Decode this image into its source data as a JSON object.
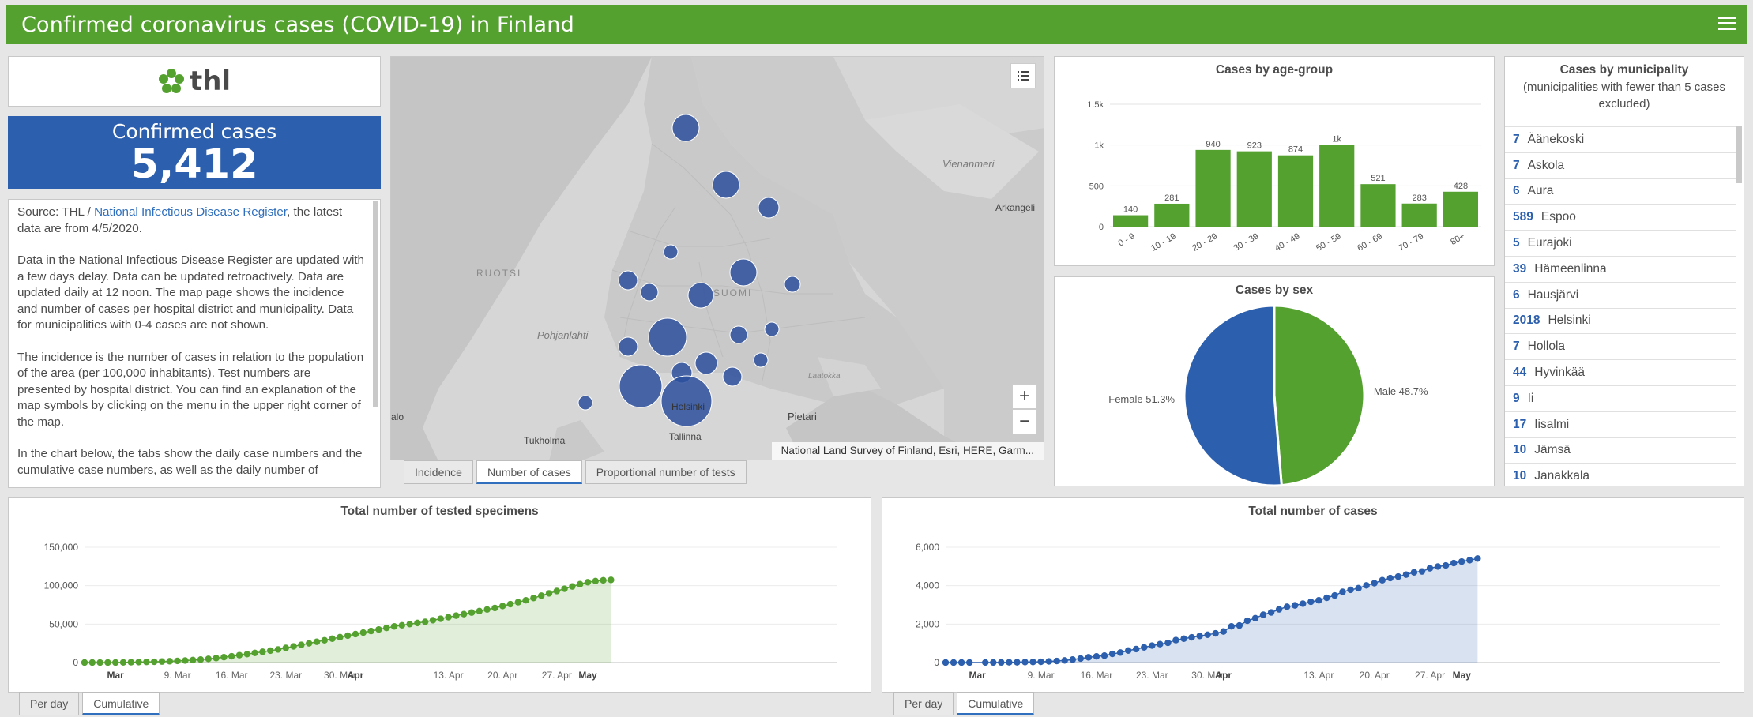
{
  "header": {
    "title": "Confirmed coronavirus cases (COVID-19) in Finland",
    "menu_icon": "hamburger-menu-icon"
  },
  "logo": {
    "text": "thl",
    "icon": "thl-flower-logo-icon",
    "color": "#55a130"
  },
  "confirmed": {
    "label": "Confirmed cases",
    "value": "5,412"
  },
  "info": {
    "p1_pre": "Source: THL / ",
    "p1_link": "National Infectious Disease Register",
    "p1_post": ", the latest data are from 4/5/2020.",
    "p2": "Data in the National Infectious Disease Register are updated with a few days delay. Data can be updated retroactively. Data are updated daily at 12 noon. The map page shows the incidence and number of cases per hospital district and municipality. Data for municipalities with 0-4 cases are not shown.",
    "p3": "The incidence is the number of cases in relation to the population of the area (per 100,000 inhabitants). Test numbers are presented by hospital district. You can find an explanation of the map symbols by clicking on the menu in the upper right corner of the map.",
    "p4": "In the chart below, the tabs show the daily case numbers and the cumulative case numbers, as well as the daily number of"
  },
  "map": {
    "labels": {
      "ruotsi": "RUOTSI",
      "suomi": "SUOMI",
      "pohjanlahti": "Pohjanlahti",
      "vienanmeri": "Vienanmeri",
      "arkangeli": "Arkangeli",
      "helsinki": "Helsinki",
      "tallinna": "Tallinna",
      "tukholma": "Tukholma",
      "pietari": "Pietari",
      "laatokka": "Laatokka",
      "alo": "alo"
    },
    "attribution": "National Land Survey of Finland, Esri, HERE, Garm...",
    "zoom_in": "+",
    "zoom_out": "−",
    "tabs": [
      "Incidence",
      "Number of cases",
      "Proportional number of tests"
    ],
    "active_tab": 1
  },
  "age_chart": {
    "title": "Cases by age-group",
    "chart_data": {
      "type": "bar",
      "title": "Cases by age-group",
      "categories": [
        "0 - 9",
        "10 - 19",
        "20 - 29",
        "30 - 39",
        "40 - 49",
        "50 - 59",
        "60 - 69",
        "70 - 79",
        "80+"
      ],
      "values": [
        140,
        281,
        940,
        923,
        874,
        1000,
        521,
        283,
        428
      ],
      "value_labels": [
        "140",
        "281",
        "940",
        "923",
        "874",
        "1k",
        "521",
        "283",
        "428"
      ],
      "yticks": [
        "0",
        "500",
        "1k",
        "1.5k"
      ],
      "ylim": [
        0,
        1500
      ],
      "color": "#55a130"
    }
  },
  "sex_chart": {
    "title": "Cases by sex",
    "chart_data": {
      "type": "pie",
      "title": "Cases by sex",
      "slices": [
        {
          "label": "Male 48.7%",
          "value": 48.7,
          "color": "#55a130"
        },
        {
          "label": "Female 51.3%",
          "value": 51.3,
          "color": "#2c5fad"
        }
      ]
    }
  },
  "municipality": {
    "title": "Cases by municipality",
    "subtitle": "(municipalities with fewer than 5 cases excluded)",
    "items": [
      {
        "count": "7",
        "name": "Äänekoski"
      },
      {
        "count": "7",
        "name": "Askola"
      },
      {
        "count": "6",
        "name": "Aura"
      },
      {
        "count": "589",
        "name": "Espoo"
      },
      {
        "count": "5",
        "name": "Eurajoki"
      },
      {
        "count": "39",
        "name": "Hämeenlinna"
      },
      {
        "count": "6",
        "name": "Hausjärvi"
      },
      {
        "count": "2018",
        "name": "Helsinki"
      },
      {
        "count": "7",
        "name": "Hollola"
      },
      {
        "count": "44",
        "name": "Hyvinkää"
      },
      {
        "count": "9",
        "name": "Ii"
      },
      {
        "count": "17",
        "name": "Iisalmi"
      },
      {
        "count": "10",
        "name": "Jämsä"
      },
      {
        "count": "10",
        "name": "Janakkala"
      }
    ]
  },
  "tested_chart": {
    "title": "Total number of tested specimens",
    "chart_data": {
      "type": "area",
      "title": "Total number of tested specimens",
      "x_start": "2020-02-26",
      "x_ticks": [
        "Mar",
        "9. Mar",
        "16. Mar",
        "23. Mar",
        "30. Mar",
        "Apr",
        "13. Apr",
        "20. Apr",
        "27. Apr",
        "May"
      ],
      "yticks": [
        "0",
        "50,000",
        "100,000",
        "150,000"
      ],
      "ylim": [
        0,
        150000
      ],
      "values": [
        0,
        0,
        0,
        0,
        0,
        200,
        400,
        600,
        800,
        1000,
        1300,
        1700,
        2100,
        2600,
        3200,
        3900,
        4800,
        5800,
        7000,
        8200,
        9600,
        11000,
        12500,
        14000,
        15500,
        17000,
        19000,
        21000,
        23000,
        25000,
        27000,
        29000,
        31000,
        33000,
        35000,
        37000,
        39000,
        41000,
        43000,
        45000,
        47000,
        48500,
        50000,
        51500,
        53000,
        55000,
        57000,
        59000,
        61000,
        63000,
        65000,
        67000,
        69000,
        71000,
        73500,
        76000,
        78500,
        81000,
        84000,
        87000,
        90000,
        93000,
        96000,
        99000,
        102000,
        104500,
        106000,
        107000,
        107500
      ],
      "color": "#55a130"
    },
    "tabs": [
      "Per day",
      "Cumulative"
    ],
    "active_tab": 1
  },
  "total_chart": {
    "title": "Total number of cases",
    "chart_data": {
      "type": "area",
      "title": "Total number of cases",
      "x_start": "2020-02-26",
      "x_ticks": [
        "Mar",
        "9. Mar",
        "16. Mar",
        "23. Mar",
        "30. Mar",
        "Apr",
        "13. Apr",
        "20. Apr",
        "27. Apr",
        "May"
      ],
      "yticks": [
        "0",
        "2,000",
        "4,000",
        "6,000"
      ],
      "ylim": [
        0,
        6000
      ],
      "values": [
        1,
        1,
        1,
        1,
        null,
        2,
        3,
        6,
        12,
        15,
        25,
        30,
        40,
        59,
        80,
        110,
        155,
        210,
        272,
        320,
        360,
        450,
        520,
        625,
        700,
        790,
        880,
        958,
        1025,
        1167,
        1240,
        1314,
        1384,
        1446,
        1518,
        1615,
        1882,
        1927,
        2176,
        2308,
        2487,
        2605,
        2769,
        2905,
        2974,
        3064,
        3161,
        3237,
        3369,
        3489,
        3681,
        3783,
        3868,
        4014,
        4129,
        4284,
        4395,
        4475,
        4576,
        4695,
        4740,
        4906,
        4995,
        5051,
        5176,
        5254,
        5327,
        5412
      ],
      "color": "#2c5fad"
    },
    "tabs": [
      "Per day",
      "Cumulative"
    ],
    "active_tab": 1
  }
}
